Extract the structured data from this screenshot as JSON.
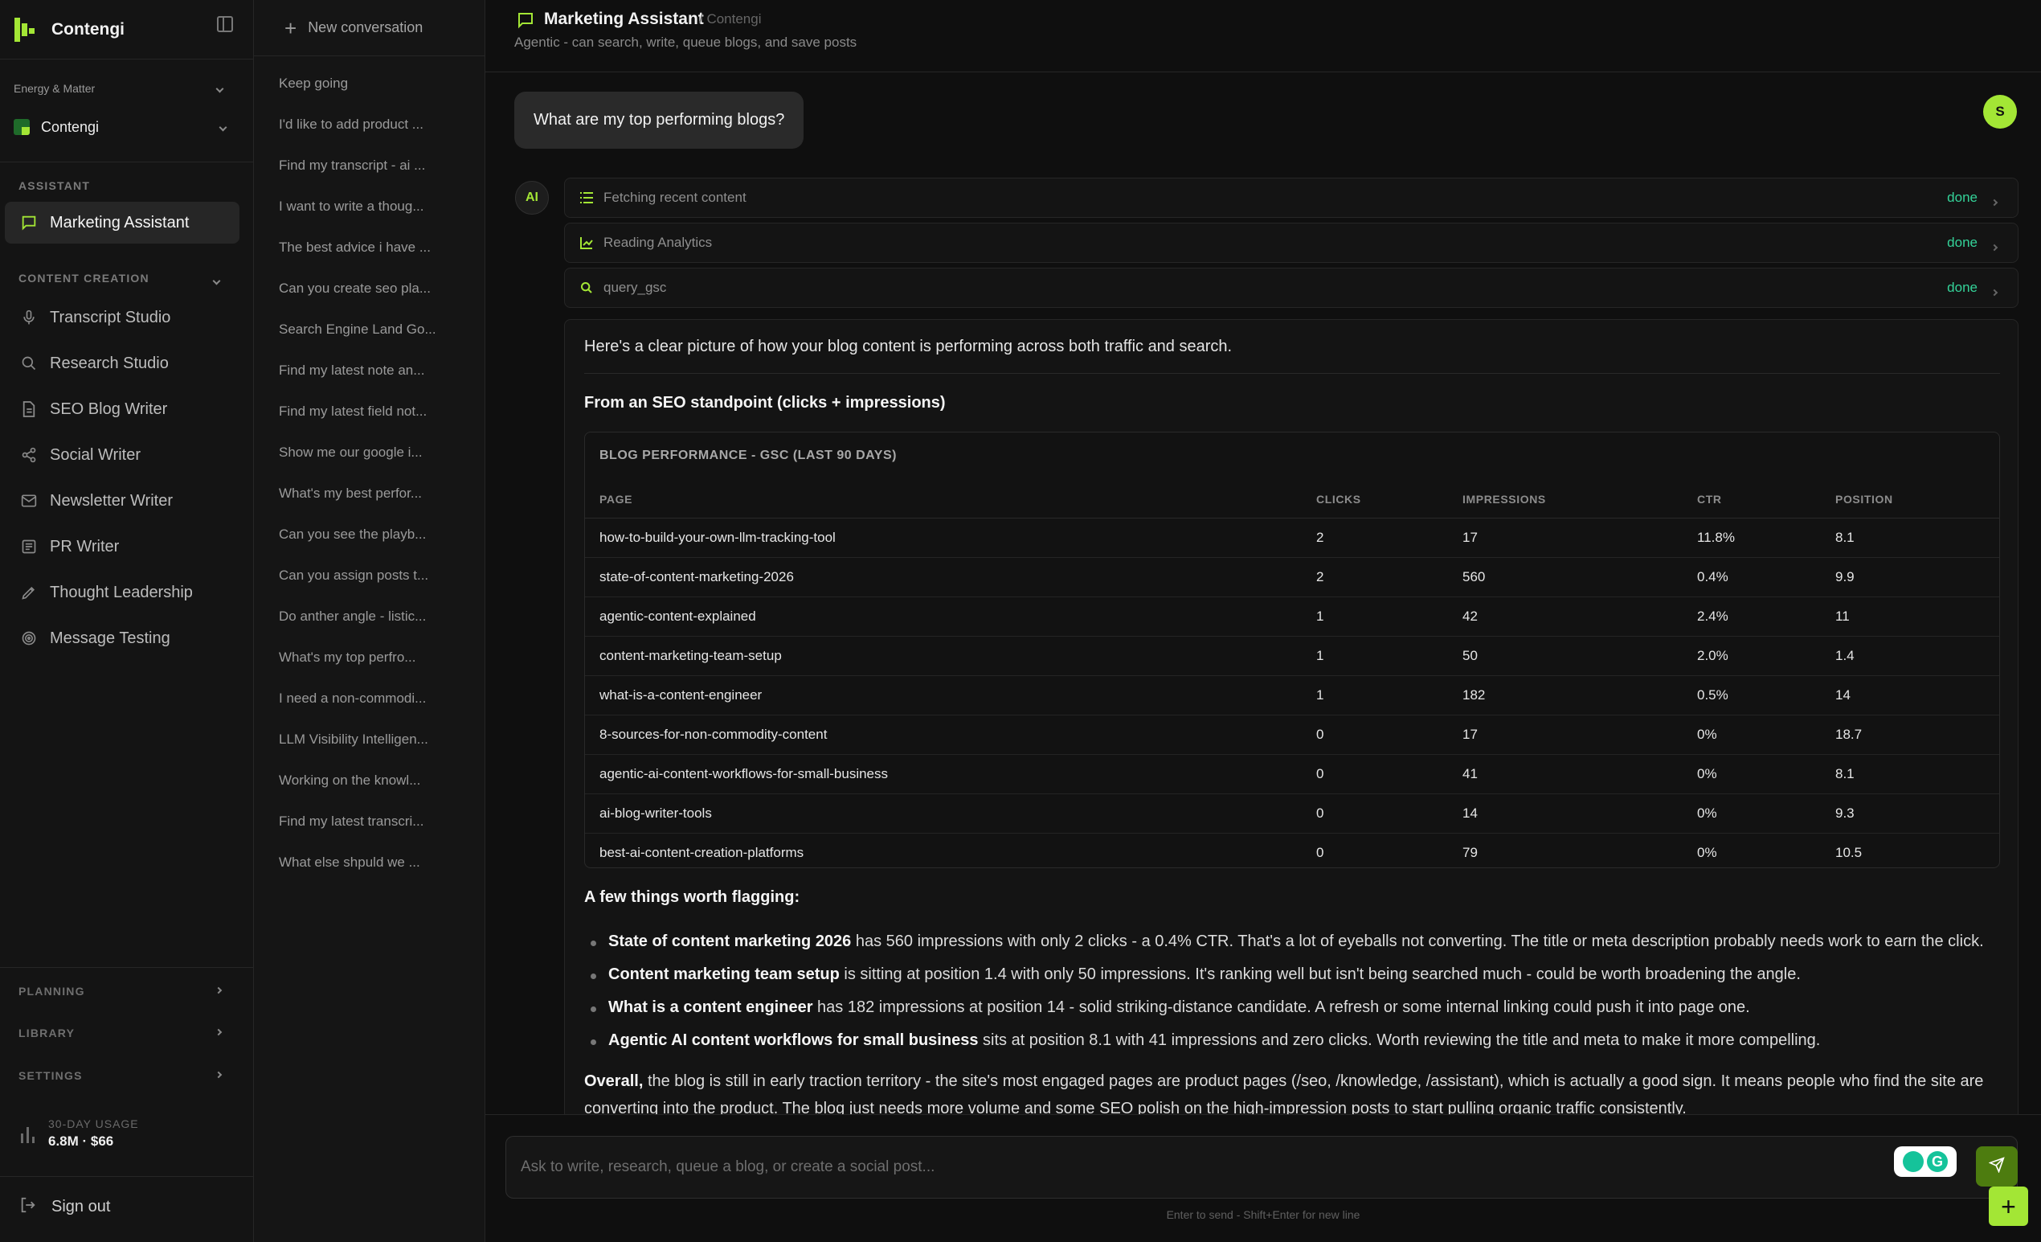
{
  "brand": {
    "name": "Contengi"
  },
  "workspace": {
    "org": "Energy & Matter",
    "name": "Contengi"
  },
  "sidebar": {
    "assistant_section": "ASSISTANT",
    "active_item": "Marketing Assistant",
    "content_section": "CONTENT CREATION",
    "items": [
      {
        "label": "Transcript Studio",
        "icon": "microphone-icon"
      },
      {
        "label": "Research Studio",
        "icon": "search-icon"
      },
      {
        "label": "SEO Blog Writer",
        "icon": "document-icon"
      },
      {
        "label": "Social Writer",
        "icon": "share-icon"
      },
      {
        "label": "Newsletter Writer",
        "icon": "mail-icon"
      },
      {
        "label": "PR Writer",
        "icon": "newspaper-icon"
      },
      {
        "label": "Thought Leadership",
        "icon": "pen-icon"
      },
      {
        "label": "Message Testing",
        "icon": "target-icon"
      }
    ],
    "collapsed_sections": [
      "PLANNING",
      "LIBRARY",
      "SETTINGS"
    ],
    "usage_label": "30-DAY USAGE",
    "usage_value": "6.8M · $66",
    "signout": "Sign out"
  },
  "conversations": {
    "new_label": "New conversation",
    "items": [
      "Keep going",
      "I'd like to add product ...",
      "Find my transcript - ai ...",
      "I want to write a thoug...",
      "The best advice i have ...",
      "Can you create seo pla...",
      "Search Engine Land Go...",
      "Find my latest note an...",
      "Find my latest field not...",
      "Show me our google i...",
      "What's my best perfor...",
      "Can you see the playb...",
      "Can you assign posts t...",
      "Do anther angle - listic...",
      "What's my top perfro...",
      "I need a non-commodi...",
      "LLM Visibility Intelligen...",
      "Working on the knowl...",
      "Find my latest transcri...",
      "What else shpuld we ..."
    ]
  },
  "header": {
    "title": "Marketing Assistant",
    "crumb": "/ Contengi",
    "subtitle": "Agentic - can search, write, queue blogs, and save posts"
  },
  "chat": {
    "user_message": "What are my top performing blogs?",
    "user_initial": "S",
    "ai_label": "AI",
    "tools": [
      {
        "label": "Fetching recent content",
        "status": "done",
        "icon": "list-icon"
      },
      {
        "label": "Reading Analytics",
        "status": "done",
        "icon": "chart-icon"
      },
      {
        "label": "query_gsc",
        "status": "done",
        "icon": "search-icon"
      }
    ],
    "intro": "Here's a clear picture of how your blog content is performing across both traffic and search.",
    "seo_heading": "From an SEO standpoint (clicks + impressions)",
    "table": {
      "title": "BLOG PERFORMANCE - GSC (LAST 90 DAYS)",
      "columns": [
        "PAGE",
        "CLICKS",
        "IMPRESSIONS",
        "CTR",
        "POSITION"
      ],
      "rows": [
        [
          "how-to-build-your-own-llm-tracking-tool",
          "2",
          "17",
          "11.8%",
          "8.1"
        ],
        [
          "state-of-content-marketing-2026",
          "2",
          "560",
          "0.4%",
          "9.9"
        ],
        [
          "agentic-content-explained",
          "1",
          "42",
          "2.4%",
          "11"
        ],
        [
          "content-marketing-team-setup",
          "1",
          "50",
          "2.0%",
          "1.4"
        ],
        [
          "what-is-a-content-engineer",
          "1",
          "182",
          "0.5%",
          "14"
        ],
        [
          "8-sources-for-non-commodity-content",
          "0",
          "17",
          "0%",
          "18.7"
        ],
        [
          "agentic-ai-content-workflows-for-small-business",
          "0",
          "41",
          "0%",
          "8.1"
        ],
        [
          "ai-blog-writer-tools",
          "0",
          "14",
          "0%",
          "9.3"
        ],
        [
          "best-ai-content-creation-platforms",
          "0",
          "79",
          "0%",
          "10.5"
        ]
      ]
    },
    "flag_heading": "A few things worth flagging:",
    "bullets": [
      {
        "bold": "State of content marketing 2026",
        "text": " has 560 impressions with only 2 clicks - a 0.4% CTR. That's a lot of eyeballs not converting. The title or meta description probably needs work to earn the click."
      },
      {
        "bold": "Content marketing team setup",
        "text": " is sitting at position 1.4 with only 50 impressions. It's ranking well but isn't being searched much - could be worth broadening the angle."
      },
      {
        "bold": "What is a content engineer",
        "text": " has 182 impressions at position 14 - solid striking-distance candidate. A refresh or some internal linking could push it into page one."
      },
      {
        "bold": "Agentic AI content workflows for small business",
        "text": " sits at position 8.1 with 41 impressions and zero clicks. Worth reviewing the title and meta to make it more compelling."
      }
    ],
    "overall_bold": "Overall,",
    "overall_text": " the blog is still in early traction territory - the site's most engaged pages are product pages (/seo, /knowledge, /assistant), which is actually a good sign. It means people who find the site are converting into the product. The blog just needs more volume and some SEO polish on the high-impression posts to start pulling organic traffic consistently."
  },
  "composer": {
    "placeholder": "Ask to write, research, queue a blog, or create a social post...",
    "hint": "Enter to send - Shift+Enter for new line",
    "g_label": "G"
  },
  "colors": {
    "accent": "#a3e635",
    "done": "#34d399",
    "bg": "#0f0f0f"
  }
}
